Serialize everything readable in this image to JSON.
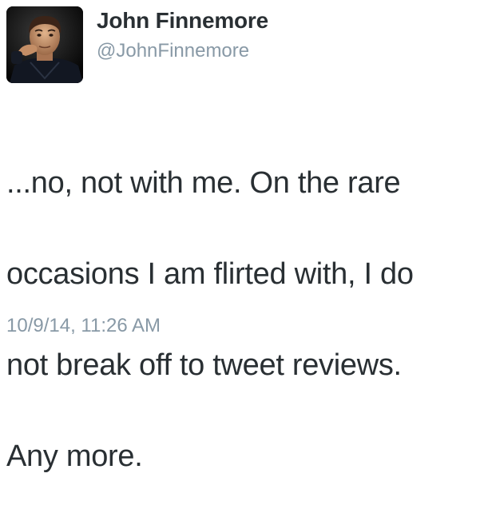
{
  "author": {
    "display_name": "John Finnemore",
    "handle": "@JohnFinnemore",
    "avatar_icon": "profile-photo"
  },
  "tweet": {
    "lines": [
      "...no, not with me. On the rare",
      "occasions I am flirted with, I do",
      "not break off to tweet reviews.",
      "Any more."
    ],
    "timestamp": "10/9/14, 11:26 AM"
  },
  "colors": {
    "name": "#292f33",
    "secondary": "#8899a6",
    "text": "#292f33"
  }
}
